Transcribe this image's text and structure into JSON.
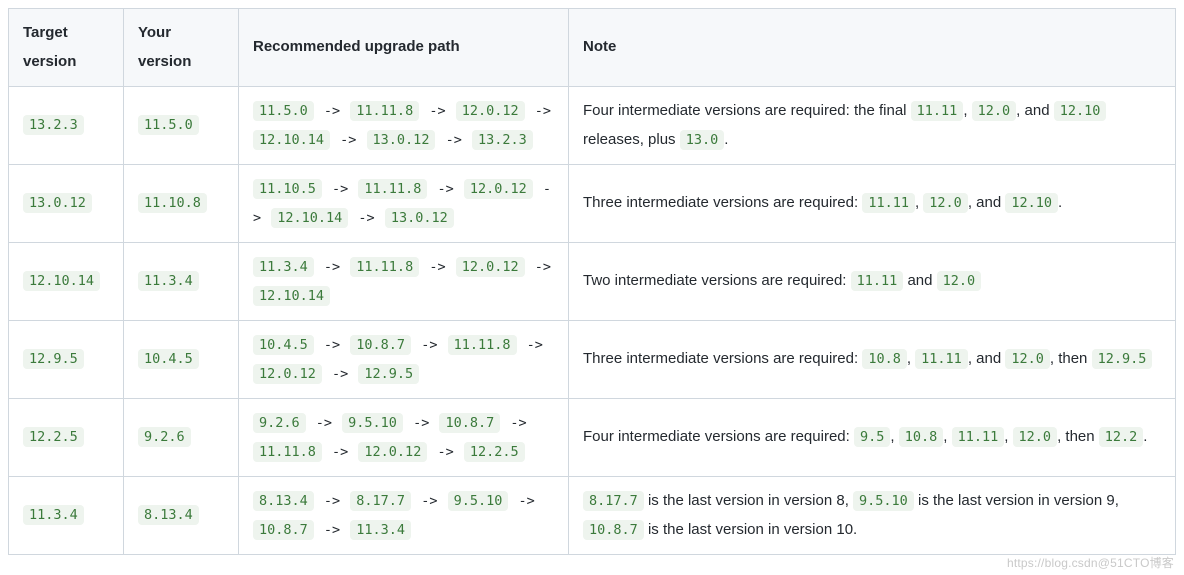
{
  "headers": {
    "target": "Target version",
    "your": "Your version",
    "path": "Recommended upgrade path",
    "note": "Note"
  },
  "rows": [
    {
      "target": "13.2.3",
      "your": "11.5.0",
      "path": [
        "11.5.0",
        "11.11.8",
        "12.0.12",
        "12.10.14",
        "13.0.12",
        "13.2.3"
      ],
      "note": [
        {
          "t": "text",
          "v": "Four intermediate versions are required: the final "
        },
        {
          "t": "code",
          "v": "11.11"
        },
        {
          "t": "text",
          "v": ", "
        },
        {
          "t": "code",
          "v": "12.0"
        },
        {
          "t": "text",
          "v": ", and "
        },
        {
          "t": "code",
          "v": "12.10"
        },
        {
          "t": "text",
          "v": " releases, plus "
        },
        {
          "t": "code",
          "v": "13.0"
        },
        {
          "t": "text",
          "v": "."
        }
      ]
    },
    {
      "target": "13.0.12",
      "your": "11.10.8",
      "path": [
        "11.10.5",
        "11.11.8",
        "12.0.12",
        "12.10.14",
        "13.0.12"
      ],
      "note": [
        {
          "t": "text",
          "v": "Three intermediate versions are required: "
        },
        {
          "t": "code",
          "v": "11.11"
        },
        {
          "t": "text",
          "v": ", "
        },
        {
          "t": "code",
          "v": "12.0"
        },
        {
          "t": "text",
          "v": ", and "
        },
        {
          "t": "code",
          "v": "12.10"
        },
        {
          "t": "text",
          "v": "."
        }
      ]
    },
    {
      "target": "12.10.14",
      "your": "11.3.4",
      "path": [
        "11.3.4",
        "11.11.8",
        "12.0.12",
        "12.10.14"
      ],
      "note": [
        {
          "t": "text",
          "v": "Two intermediate versions are required: "
        },
        {
          "t": "code",
          "v": "11.11"
        },
        {
          "t": "text",
          "v": " and "
        },
        {
          "t": "code",
          "v": "12.0"
        }
      ]
    },
    {
      "target": "12.9.5",
      "your": "10.4.5",
      "path": [
        "10.4.5",
        "10.8.7",
        "11.11.8",
        "12.0.12",
        "12.9.5"
      ],
      "note": [
        {
          "t": "text",
          "v": "Three intermediate versions are required: "
        },
        {
          "t": "code",
          "v": "10.8"
        },
        {
          "t": "text",
          "v": ", "
        },
        {
          "t": "code",
          "v": "11.11"
        },
        {
          "t": "text",
          "v": ", and "
        },
        {
          "t": "code",
          "v": "12.0"
        },
        {
          "t": "text",
          "v": ", then "
        },
        {
          "t": "code",
          "v": "12.9.5"
        }
      ]
    },
    {
      "target": "12.2.5",
      "your": "9.2.6",
      "path": [
        "9.2.6",
        "9.5.10",
        "10.8.7",
        "11.11.8",
        "12.0.12",
        "12.2.5"
      ],
      "note": [
        {
          "t": "text",
          "v": "Four intermediate versions are required: "
        },
        {
          "t": "code",
          "v": "9.5"
        },
        {
          "t": "text",
          "v": ", "
        },
        {
          "t": "code",
          "v": "10.8"
        },
        {
          "t": "text",
          "v": ", "
        },
        {
          "t": "code",
          "v": "11.11"
        },
        {
          "t": "text",
          "v": ", "
        },
        {
          "t": "code",
          "v": "12.0"
        },
        {
          "t": "text",
          "v": ", then "
        },
        {
          "t": "code",
          "v": "12.2"
        },
        {
          "t": "text",
          "v": "."
        }
      ]
    },
    {
      "target": "11.3.4",
      "your": "8.13.4",
      "path": [
        "8.13.4",
        "8.17.7",
        "9.5.10",
        "10.8.7",
        "11.3.4"
      ],
      "note": [
        {
          "t": "code",
          "v": "8.17.7"
        },
        {
          "t": "text",
          "v": " is the last version in version 8, "
        },
        {
          "t": "code",
          "v": "9.5.10"
        },
        {
          "t": "text",
          "v": " is the last version in version 9, "
        },
        {
          "t": "code",
          "v": "10.8.7"
        },
        {
          "t": "text",
          "v": " is the last version in version 10."
        }
      ]
    }
  ],
  "arrow": " -> ",
  "watermark": "https://blog.csdn@51CTO博客"
}
